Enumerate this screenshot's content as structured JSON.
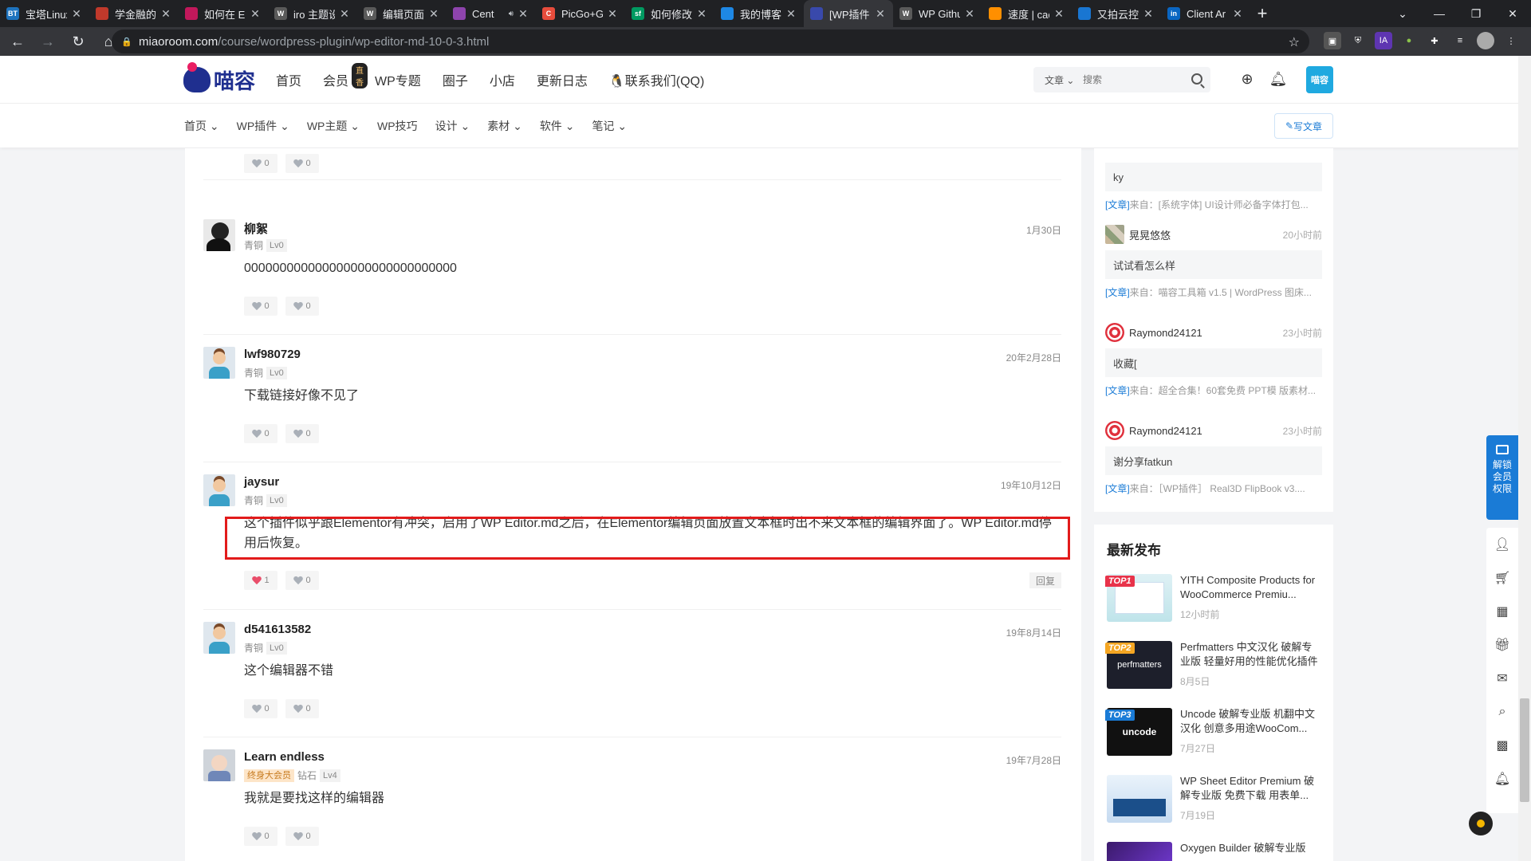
{
  "browser": {
    "tabs": [
      {
        "fav": "BT",
        "favColor": "#1e73be",
        "title": "宝塔Linux"
      },
      {
        "fav": "",
        "favColor": "#c0392b",
        "title": "学金融的?"
      },
      {
        "fav": "",
        "favColor": "#c2185b",
        "title": "如何在 Ele"
      },
      {
        "fav": "W",
        "favColor": "#5a5a5a",
        "title": "iro 主题设"
      },
      {
        "fav": "W",
        "favColor": "#5a5a5a",
        "title": "编辑页面"
      },
      {
        "fav": "",
        "favColor": "#8e44ad",
        "title": "Cent"
      },
      {
        "fav": "C",
        "favColor": "#e74c3c",
        "title": "PicGo+G"
      },
      {
        "fav": "sf",
        "favColor": "#009a61",
        "title": "如何修改"
      },
      {
        "fav": "",
        "favColor": "#1e88e5",
        "title": "我的博客"
      },
      {
        "fav": "",
        "favColor": "#3949ab",
        "title": "[WP插件"
      },
      {
        "fav": "W",
        "favColor": "#5a5a5a",
        "title": "WP Githu"
      },
      {
        "fav": "",
        "favColor": "#ff8f00",
        "title": "速度 | cac"
      },
      {
        "fav": "",
        "favColor": "#1976d2",
        "title": "又拍云控"
      },
      {
        "fav": "in",
        "favColor": "#0a66c2",
        "title": "Client Ar"
      }
    ],
    "url_host": "miaoroom.com",
    "url_path": "/course/wordpress-plugin/wp-editor-md-10-0-3.html"
  },
  "header": {
    "logo_text": "喵容",
    "nav": [
      "首页",
      "会员",
      "WP专题",
      "圈子",
      "小店",
      "更新日志",
      "联系我们(QQ)"
    ],
    "vip_badge": "直香",
    "search_scope": "文章",
    "search_placeholder": "搜索",
    "avatar_text": "喵容"
  },
  "subnav": {
    "items": [
      "首页",
      "WP插件",
      "WP主题",
      "WP技巧",
      "设计",
      "素材",
      "软件",
      "笔记"
    ],
    "write_button": "写文章"
  },
  "comments": [
    {
      "name": "",
      "rank": "",
      "lv": "",
      "date": "",
      "text": "",
      "likes": "0",
      "dislikes": "0"
    },
    {
      "name": "柳絮",
      "rank": "青铜",
      "lv": "Lv0",
      "date": "1月30日",
      "text": "000000000000000000000000000000",
      "likes": "0",
      "dislikes": "0"
    },
    {
      "name": "lwf980729",
      "rank": "青铜",
      "lv": "Lv0",
      "date": "20年2月28日",
      "text": "下载链接好像不见了",
      "likes": "0",
      "dislikes": "0"
    },
    {
      "name": "jaysur",
      "rank": "青铜",
      "lv": "Lv0",
      "date": "19年10月12日",
      "text": "这个插件似乎跟Elementor有冲突，启用了WP Editor.md之后，在Elementor编辑页面放置文本框时出不来文本框的编辑界面了。WP Editor.md停用后恢复。",
      "likes": "1",
      "dislikes": "0",
      "reply": "回复"
    },
    {
      "name": "d541613582",
      "rank": "青铜",
      "lv": "Lv0",
      "date": "19年8月14日",
      "text": "这个编辑器不错",
      "likes": "0",
      "dislikes": "0"
    },
    {
      "name": "Learn endless",
      "vip": "终身大会员",
      "rank": "钻石",
      "lv": "Lv4",
      "date": "19年7月28日",
      "text": "我就是要找这样的编辑器",
      "likes": "0",
      "dislikes": "0"
    }
  ],
  "recent_comments": [
    {
      "name": "",
      "time": "",
      "body": "ky",
      "from_tag": "[文章]",
      "from": "来自：[系统字体] UI设计师必备字体打包..."
    },
    {
      "name": "晃晃悠悠",
      "time": "20小时前",
      "body": "试试看怎么样",
      "from_tag": "[文章]",
      "from": "来自：喵容工具箱 v1.5 | WordPress 图床..."
    },
    {
      "name": "Raymond24121",
      "time": "23小时前",
      "body": "收藏[",
      "from_tag": "[文章]",
      "from": "来自：超全合集！60套免费 PPT模 版素材..."
    },
    {
      "name": "Raymond24121",
      "time": "23小时前",
      "body": "谢分享fatkun",
      "from_tag": "[文章]",
      "from": "来自：［WP插件］ Real3D FlipBook v3...."
    }
  ],
  "latest": {
    "title": "最新发布",
    "posts": [
      {
        "top": "TOP1",
        "topColor": "#e8334a",
        "title": "YITH Composite Products for WooCommerce Premiu...",
        "date": "12小时前"
      },
      {
        "top": "TOP2",
        "topColor": "#f5a623",
        "title": "Perfmatters 中文汉化 破解专业版 轻量好用的性能优化插件",
        "date": "8月5日"
      },
      {
        "top": "TOP3",
        "topColor": "#1a7bd6",
        "title": "Uncode 破解专业版 机翻中文汉化 创意多用途WooCom...",
        "date": "7月27日"
      },
      {
        "top": "",
        "topColor": "",
        "title": "WP Sheet Editor Premium 破解专业版 免费下载 用表单...",
        "date": "7月19日"
      },
      {
        "top": "",
        "topColor": "",
        "title": "Oxygen Builder 破解专业版",
        "date": ""
      }
    ]
  },
  "float": {
    "unlock_label": "解锁会员权限"
  }
}
